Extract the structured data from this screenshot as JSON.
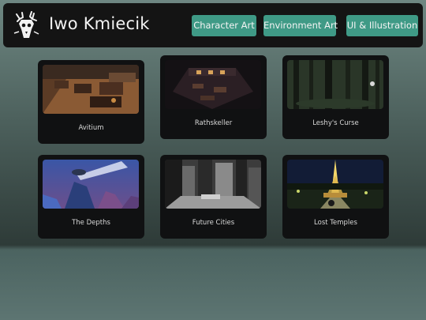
{
  "header": {
    "title": "Iwo Kmiecik",
    "logo_icon": "deer-skull-logo-icon",
    "nav": [
      {
        "label": "Character Art"
      },
      {
        "label": "Environment Art"
      },
      {
        "label": "UI & Illustration"
      }
    ]
  },
  "colors": {
    "header_bg": "#141414",
    "nav_button": "#3f9a86",
    "card_bg": "#101112"
  },
  "gallery": [
    {
      "title": "Avitium"
    },
    {
      "title": "Rathskeller"
    },
    {
      "title": "Leshy's Curse"
    },
    {
      "title": "The Depths"
    },
    {
      "title": "Future Cities"
    },
    {
      "title": "Lost Temples"
    }
  ]
}
